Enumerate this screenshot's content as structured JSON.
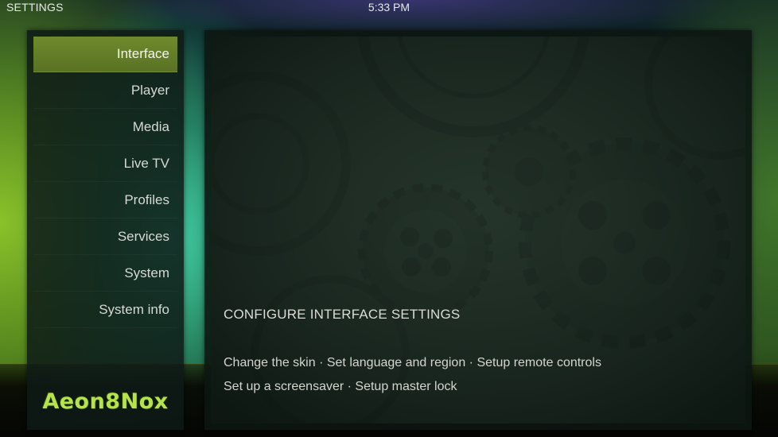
{
  "header": {
    "title": "SETTINGS",
    "clock": "5:33 PM"
  },
  "sidebar": {
    "items": [
      {
        "label": "Interface",
        "active": true
      },
      {
        "label": "Player",
        "active": false
      },
      {
        "label": "Media",
        "active": false
      },
      {
        "label": "Live TV",
        "active": false
      },
      {
        "label": "Profiles",
        "active": false
      },
      {
        "label": "Services",
        "active": false
      },
      {
        "label": "System",
        "active": false
      },
      {
        "label": "System info",
        "active": false
      }
    ],
    "logo_text": "Aeon8Nox"
  },
  "panel": {
    "heading": "CONFIGURE INTERFACE SETTINGS",
    "description_line1": "Change the skin · Set language and region · Setup remote controls",
    "description_line2": "Set up a screensaver · Setup master lock"
  },
  "colors": {
    "accent": "#6f8a2c",
    "logo": "#b6e24a",
    "text": "#d6d9d4"
  }
}
